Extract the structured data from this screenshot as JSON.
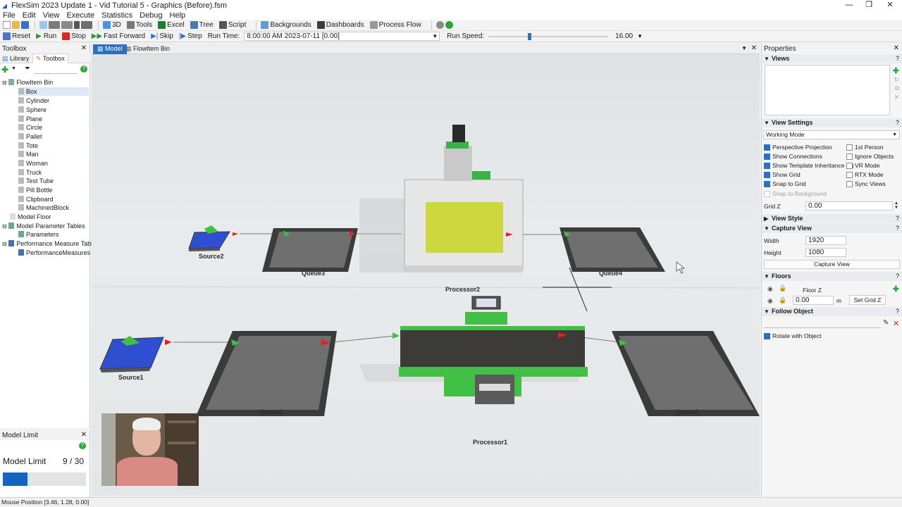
{
  "window": {
    "title": "FlexSim 2023 Update 1 - Vid Tutorial 5 - Graphics (Before).fsm"
  },
  "menu": [
    "File",
    "Edit",
    "View",
    "Execute",
    "Statistics",
    "Debug",
    "Help"
  ],
  "toolbar": {
    "threeD": "3D",
    "tools": "Tools",
    "excel": "Excel",
    "tree": "Tree",
    "script": "Script",
    "backgrounds": "Backgrounds",
    "dashboards": "Dashboards",
    "process_flow": "Process Flow"
  },
  "runbar": {
    "reset": "Reset",
    "run": "Run",
    "stop": "Stop",
    "fast_forward": "Fast Forward",
    "skip": "Skip",
    "step": "Step",
    "run_time_label": "Run Time:",
    "run_time_value": "8:00:00 AM  2023-07-11  [0.00]",
    "run_speed_label": "Run Speed:",
    "run_speed_value": "16.00"
  },
  "toolbox": {
    "header": "Toolbox",
    "tabs": [
      "Library",
      "Toolbox"
    ],
    "tree": [
      "FlowItem Bin",
      "Box",
      "Cylinder",
      "Sphere",
      "Plane",
      "Circle",
      "Pallet",
      "Tote",
      "Man",
      "Woman",
      "Truck",
      "Test Tube",
      "Pill Bottle",
      "Clipboard",
      "MachinedBlock",
      "Model Floor",
      "Model Parameter Tables",
      "Parameters",
      "Performance Measure Tables",
      "PerformanceMeasures"
    ]
  },
  "model_limit": {
    "header": "Model Limit",
    "label": "Model Limit",
    "value": "9 / 30",
    "fraction": 0.3
  },
  "viewport": {
    "tabs": [
      "Model",
      "FlowItem Bin"
    ],
    "objects": {
      "source1": "Source1",
      "source2": "Source2",
      "queue1": "Queue1",
      "queue2": "Queue2",
      "queue3": "Queue3",
      "queue4": "Queue4",
      "processor1": "Processor1",
      "processor2": "Processor2"
    }
  },
  "properties": {
    "header": "Properties",
    "views_title": "Views",
    "view_settings_title": "View Settings",
    "working_mode": "Working Mode",
    "checks_left": [
      {
        "label": "Perspective Projection",
        "on": true
      },
      {
        "label": "Show Connections",
        "on": true
      },
      {
        "label": "Show Template Inheritance (T)",
        "on": true
      },
      {
        "label": "Show Grid",
        "on": true
      },
      {
        "label": "Snap to Grid",
        "on": true
      },
      {
        "label": "Snap to Background",
        "on": false
      }
    ],
    "checks_right": [
      {
        "label": "1st Person",
        "on": false
      },
      {
        "label": "Ignore Objects",
        "on": false
      },
      {
        "label": "VR Mode",
        "on": false
      },
      {
        "label": "RTX Mode",
        "on": false
      },
      {
        "label": "Sync Views",
        "on": false
      }
    ],
    "grid_z_label": "Grid Z",
    "grid_z_value": "0.00",
    "view_style_title": "View Style",
    "capture_view_title": "Capture View",
    "width_label": "Width",
    "width_value": "1920",
    "height_label": "Height",
    "height_value": "1080",
    "capture_button": "Capture View",
    "floors_title": "Floors",
    "floor_name": "Floor Z",
    "floor_value": "0.00",
    "floor_unit": "m",
    "set_grid_z": "Set Grid Z",
    "follow_title": "Follow Object",
    "rotate_label": "Rotate with Object"
  },
  "status": {
    "mouse_position": "Mouse Position [3.46, 1.28, 0.00]"
  },
  "colors": {
    "accent": "#2f6fbd",
    "machine_green": "#4cbb3c",
    "source_blue": "#2f4fd0"
  }
}
